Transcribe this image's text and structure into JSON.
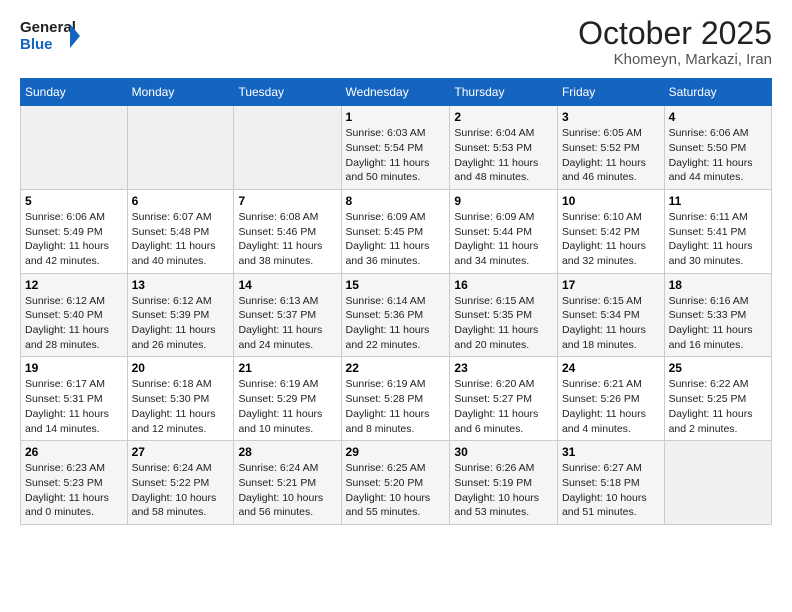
{
  "logo": {
    "line1": "General",
    "line2": "Blue"
  },
  "title": "October 2025",
  "subtitle": "Khomeyn, Markazi, Iran",
  "weekdays": [
    "Sunday",
    "Monday",
    "Tuesday",
    "Wednesday",
    "Thursday",
    "Friday",
    "Saturday"
  ],
  "weeks": [
    [
      {
        "day": "",
        "info": ""
      },
      {
        "day": "",
        "info": ""
      },
      {
        "day": "",
        "info": ""
      },
      {
        "day": "1",
        "info": "Sunrise: 6:03 AM\nSunset: 5:54 PM\nDaylight: 11 hours\nand 50 minutes."
      },
      {
        "day": "2",
        "info": "Sunrise: 6:04 AM\nSunset: 5:53 PM\nDaylight: 11 hours\nand 48 minutes."
      },
      {
        "day": "3",
        "info": "Sunrise: 6:05 AM\nSunset: 5:52 PM\nDaylight: 11 hours\nand 46 minutes."
      },
      {
        "day": "4",
        "info": "Sunrise: 6:06 AM\nSunset: 5:50 PM\nDaylight: 11 hours\nand 44 minutes."
      }
    ],
    [
      {
        "day": "5",
        "info": "Sunrise: 6:06 AM\nSunset: 5:49 PM\nDaylight: 11 hours\nand 42 minutes."
      },
      {
        "day": "6",
        "info": "Sunrise: 6:07 AM\nSunset: 5:48 PM\nDaylight: 11 hours\nand 40 minutes."
      },
      {
        "day": "7",
        "info": "Sunrise: 6:08 AM\nSunset: 5:46 PM\nDaylight: 11 hours\nand 38 minutes."
      },
      {
        "day": "8",
        "info": "Sunrise: 6:09 AM\nSunset: 5:45 PM\nDaylight: 11 hours\nand 36 minutes."
      },
      {
        "day": "9",
        "info": "Sunrise: 6:09 AM\nSunset: 5:44 PM\nDaylight: 11 hours\nand 34 minutes."
      },
      {
        "day": "10",
        "info": "Sunrise: 6:10 AM\nSunset: 5:42 PM\nDaylight: 11 hours\nand 32 minutes."
      },
      {
        "day": "11",
        "info": "Sunrise: 6:11 AM\nSunset: 5:41 PM\nDaylight: 11 hours\nand 30 minutes."
      }
    ],
    [
      {
        "day": "12",
        "info": "Sunrise: 6:12 AM\nSunset: 5:40 PM\nDaylight: 11 hours\nand 28 minutes."
      },
      {
        "day": "13",
        "info": "Sunrise: 6:12 AM\nSunset: 5:39 PM\nDaylight: 11 hours\nand 26 minutes."
      },
      {
        "day": "14",
        "info": "Sunrise: 6:13 AM\nSunset: 5:37 PM\nDaylight: 11 hours\nand 24 minutes."
      },
      {
        "day": "15",
        "info": "Sunrise: 6:14 AM\nSunset: 5:36 PM\nDaylight: 11 hours\nand 22 minutes."
      },
      {
        "day": "16",
        "info": "Sunrise: 6:15 AM\nSunset: 5:35 PM\nDaylight: 11 hours\nand 20 minutes."
      },
      {
        "day": "17",
        "info": "Sunrise: 6:15 AM\nSunset: 5:34 PM\nDaylight: 11 hours\nand 18 minutes."
      },
      {
        "day": "18",
        "info": "Sunrise: 6:16 AM\nSunset: 5:33 PM\nDaylight: 11 hours\nand 16 minutes."
      }
    ],
    [
      {
        "day": "19",
        "info": "Sunrise: 6:17 AM\nSunset: 5:31 PM\nDaylight: 11 hours\nand 14 minutes."
      },
      {
        "day": "20",
        "info": "Sunrise: 6:18 AM\nSunset: 5:30 PM\nDaylight: 11 hours\nand 12 minutes."
      },
      {
        "day": "21",
        "info": "Sunrise: 6:19 AM\nSunset: 5:29 PM\nDaylight: 11 hours\nand 10 minutes."
      },
      {
        "day": "22",
        "info": "Sunrise: 6:19 AM\nSunset: 5:28 PM\nDaylight: 11 hours\nand 8 minutes."
      },
      {
        "day": "23",
        "info": "Sunrise: 6:20 AM\nSunset: 5:27 PM\nDaylight: 11 hours\nand 6 minutes."
      },
      {
        "day": "24",
        "info": "Sunrise: 6:21 AM\nSunset: 5:26 PM\nDaylight: 11 hours\nand 4 minutes."
      },
      {
        "day": "25",
        "info": "Sunrise: 6:22 AM\nSunset: 5:25 PM\nDaylight: 11 hours\nand 2 minutes."
      }
    ],
    [
      {
        "day": "26",
        "info": "Sunrise: 6:23 AM\nSunset: 5:23 PM\nDaylight: 11 hours\nand 0 minutes."
      },
      {
        "day": "27",
        "info": "Sunrise: 6:24 AM\nSunset: 5:22 PM\nDaylight: 10 hours\nand 58 minutes."
      },
      {
        "day": "28",
        "info": "Sunrise: 6:24 AM\nSunset: 5:21 PM\nDaylight: 10 hours\nand 56 minutes."
      },
      {
        "day": "29",
        "info": "Sunrise: 6:25 AM\nSunset: 5:20 PM\nDaylight: 10 hours\nand 55 minutes."
      },
      {
        "day": "30",
        "info": "Sunrise: 6:26 AM\nSunset: 5:19 PM\nDaylight: 10 hours\nand 53 minutes."
      },
      {
        "day": "31",
        "info": "Sunrise: 6:27 AM\nSunset: 5:18 PM\nDaylight: 10 hours\nand 51 minutes."
      },
      {
        "day": "",
        "info": ""
      }
    ]
  ]
}
